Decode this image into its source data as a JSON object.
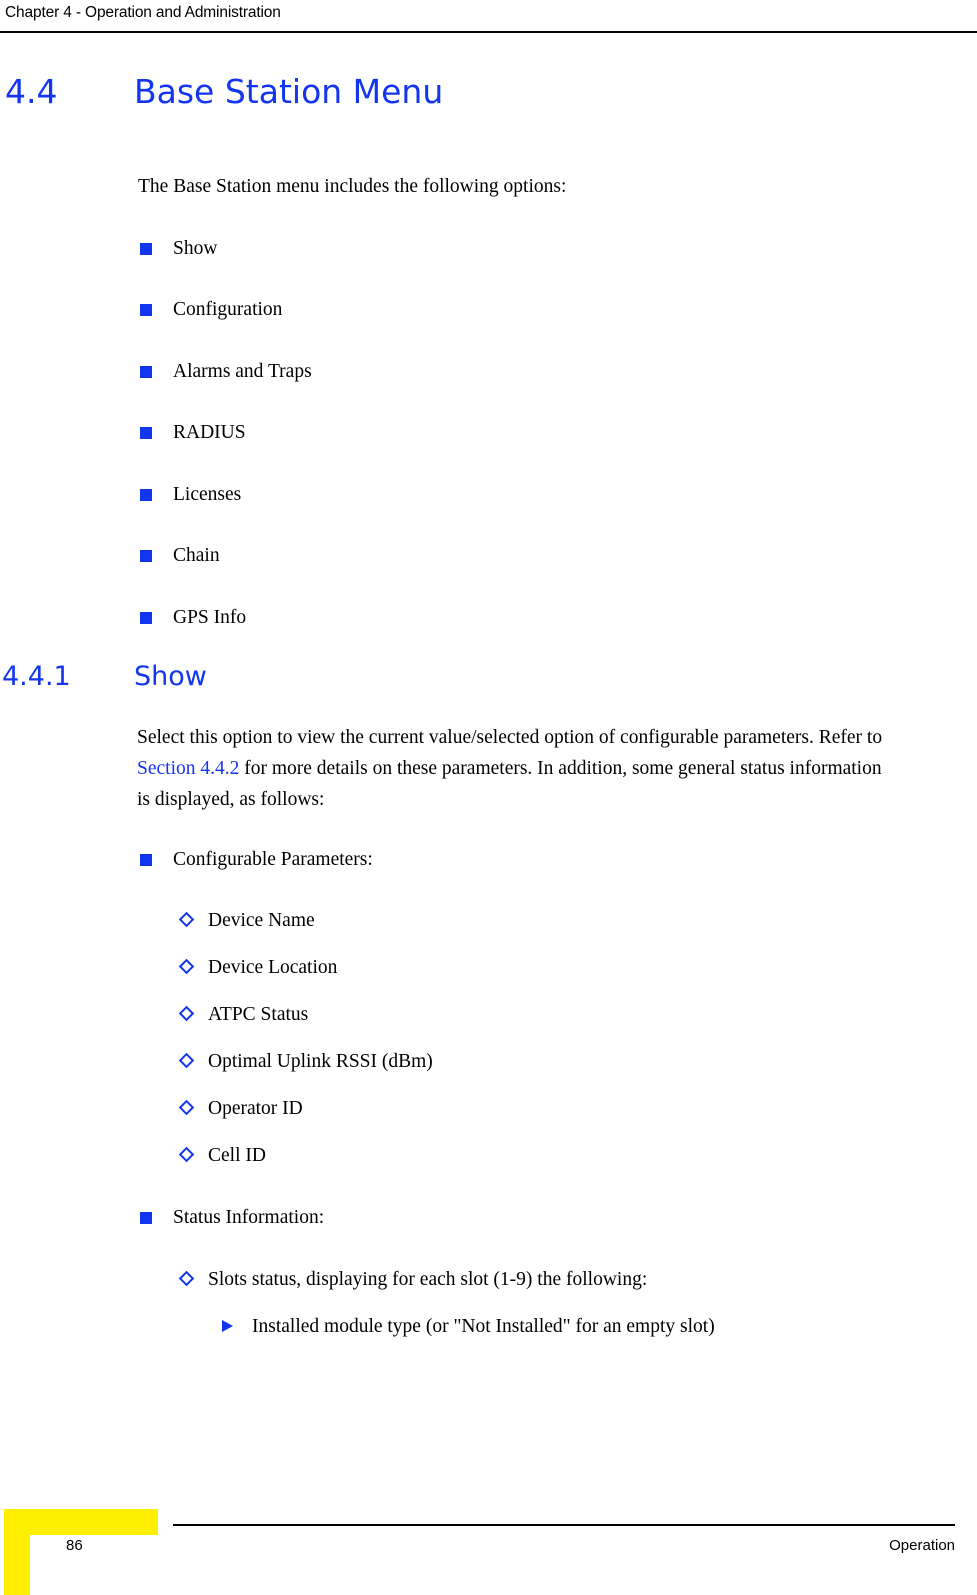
{
  "header": {
    "running_head": "Chapter 4 - Operation and Administration"
  },
  "colors": {
    "heading_blue": "#1335ef",
    "bullet_blue": "#1235ee",
    "link_blue": "#1335ef",
    "footer_yellow": "#ffef00",
    "body_text": "#000000"
  },
  "sections": {
    "main": {
      "number": "4.4",
      "title": "Base Station Menu",
      "intro": "The Base Station menu includes the following options:",
      "options": [
        {
          "label": "Show"
        },
        {
          "label": "Configuration"
        },
        {
          "label": "Alarms and Traps"
        },
        {
          "label": "RADIUS"
        },
        {
          "label": "Licenses"
        },
        {
          "label": "Chain"
        },
        {
          "label": "GPS Info"
        }
      ]
    },
    "show": {
      "number": "4.4.1",
      "title": "Show",
      "paragraph": {
        "before_link": "Select this option to view the current value/selected option of configurable parameters. Refer to ",
        "link": "Section 4.4.2",
        "after_link": " for more details on these parameters. In addition, some general status information is displayed, as follows:"
      },
      "groups": [
        {
          "label": "Configurable Parameters:",
          "items": [
            {
              "label": "Device Name"
            },
            {
              "label": "Device Location"
            },
            {
              "label": "ATPC Status"
            },
            {
              "label": "Optimal Uplink RSSI (dBm)"
            },
            {
              "label": "Operator ID"
            },
            {
              "label": "Cell ID"
            }
          ]
        },
        {
          "label": "Status Information:",
          "items": [
            {
              "label": "Slots status, displaying for each slot (1-9) the following:",
              "subitems": [
                {
                  "label": "Installed module type (or \"Not Installed\" for an empty slot)"
                }
              ]
            }
          ]
        }
      ]
    }
  },
  "footer": {
    "page_number": "86",
    "section_name": "Operation"
  }
}
